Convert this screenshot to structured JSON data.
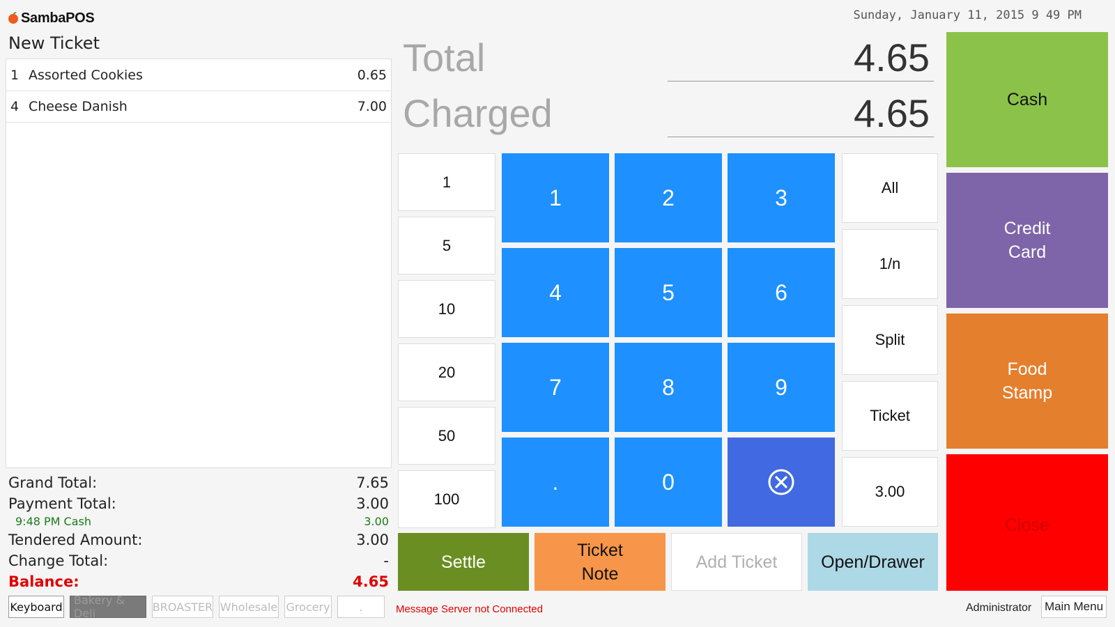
{
  "header": {
    "app_name": "SambaPOS",
    "datetime": "Sunday, January 11, 2015 9 49 PM"
  },
  "ticket": {
    "title": "New Ticket",
    "items": [
      {
        "qty": "1",
        "name": "Assorted Cookies",
        "price": "0.65"
      },
      {
        "qty": "4",
        "name": "Cheese Danish",
        "price": "7.00"
      }
    ]
  },
  "totals": {
    "grand_total_label": "Grand Total:",
    "grand_total": "7.65",
    "payment_total_label": "Payment Total:",
    "payment_total": "3.00",
    "payment_line_label": "9:48 PM  Cash",
    "payment_line_value": "3.00",
    "tendered_label": "Tendered Amount:",
    "tendered": "3.00",
    "change_label": "Change Total:",
    "change": "-",
    "balance_label": "Balance:",
    "balance": "4.65"
  },
  "display": {
    "total_label": "Total",
    "total_value": "4.65",
    "charged_label": "Charged",
    "charged_value": "4.65"
  },
  "quick_amounts": [
    "1",
    "5",
    "10",
    "20",
    "50",
    "100"
  ],
  "numpad": [
    "1",
    "2",
    "3",
    "4",
    "5",
    "6",
    "7",
    "8",
    "9",
    ".",
    "0"
  ],
  "numpad_delete_icon": "clear-circle-icon",
  "split_options": [
    "All",
    "1/n",
    "Split",
    "Ticket",
    "3.00"
  ],
  "actions": {
    "settle": "Settle",
    "ticket_note": "Ticket\nNote",
    "add_ticket": "Add Ticket",
    "open_drawer": "Open/Drawer"
  },
  "payment_types": {
    "cash": "Cash",
    "credit_card": "Credit\nCard",
    "food_stamp": "Food\nStamp",
    "close": "Close"
  },
  "tabs": [
    "Keyboard",
    "Bakery & Deli",
    "BROASTER",
    "Wholesale",
    "Grocery",
    "."
  ],
  "status": {
    "message": "Message Server not Connected",
    "user": "Administrator",
    "main_menu": "Main Menu"
  },
  "colors": {
    "numpad": "#1e90ff",
    "numpad_delete": "#4169e1",
    "cash": "#8bc34a",
    "credit_card": "#7e64a8",
    "food_stamp": "#e47f2e",
    "close": "#ff0000",
    "close_text": "#d40000",
    "settle": "#6b8e23",
    "ticket_note": "#f7964a",
    "open_drawer": "#add8e6",
    "balance": "#e00000",
    "message": "#e00000",
    "payment_line": "#1a7a1a"
  }
}
